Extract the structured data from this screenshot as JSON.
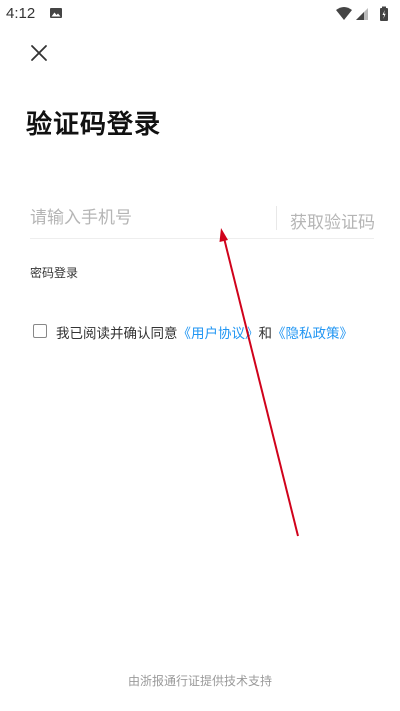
{
  "status_bar": {
    "time": "4:12",
    "icons": [
      "image-icon",
      "wifi-icon",
      "signal-icon",
      "battery-icon"
    ]
  },
  "header": {
    "close_icon": "close-icon"
  },
  "main": {
    "title": "验证码登录",
    "phone_input": {
      "placeholder": "请输入手机号",
      "value": ""
    },
    "get_code_label": "获取验证码",
    "password_login_label": "密码登录",
    "agreement": {
      "prefix": "我已阅读并确认同意",
      "user_agreement": "《用户协议》",
      "conjunction": "和",
      "privacy_policy": "《隐私政策》",
      "checked": false
    }
  },
  "footer": {
    "text": "由浙报通行证提供技术支持"
  },
  "colors": {
    "link": "#2196f3",
    "placeholder": "#b5b5b5",
    "annotation_arrow": "#d0021b"
  }
}
